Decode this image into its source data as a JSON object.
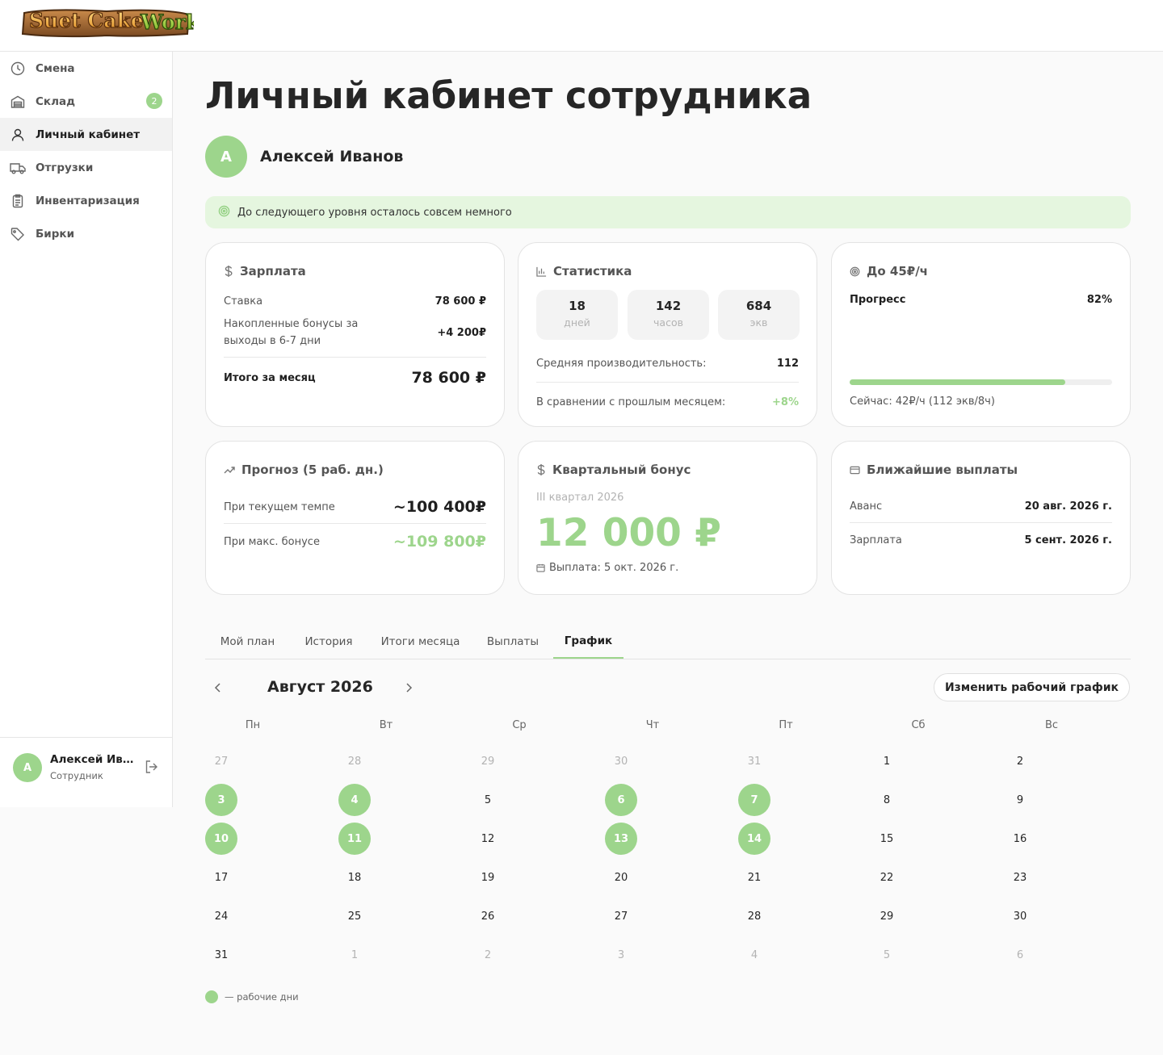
{
  "app": {
    "logo_text": "Suet Cake Work"
  },
  "sidebar": {
    "items": [
      {
        "label": "Смена",
        "icon": "clock-icon"
      },
      {
        "label": "Склад",
        "icon": "warehouse-icon",
        "badge": "2"
      },
      {
        "label": "Личный кабинет",
        "icon": "user-icon",
        "active": true
      },
      {
        "label": "Отгрузки",
        "icon": "truck-icon"
      },
      {
        "label": "Инвентаризация",
        "icon": "clipboard-icon"
      },
      {
        "label": "Бирки",
        "icon": "tag-icon"
      }
    ],
    "user": {
      "initial": "А",
      "name": "Алексей Иван...",
      "role": "Сотрудник"
    }
  },
  "page": {
    "title": "Личный кабинет сотрудника",
    "user_initial": "А",
    "user_name": "Алексей Иванов",
    "banner": "До следующего уровня осталось совсем немного"
  },
  "salary": {
    "title": "Зарплата",
    "rate_label": "Ставка",
    "rate_value": "78 600 ₽",
    "bonus_label_1": "Накопленные бонусы за",
    "bonus_label_2": "выходы в 6-7 дни",
    "bonus_value": "+4 200₽",
    "total_label": "Итого за месяц",
    "total_value": "78 600 ₽"
  },
  "stats": {
    "title": "Статистика",
    "boxes": [
      {
        "value": "18",
        "unit": "дней"
      },
      {
        "value": "142",
        "unit": "часов"
      },
      {
        "value": "684",
        "unit": "экв"
      }
    ],
    "avg_label": "Средняя производительность:",
    "avg_value": "112",
    "compare_label": "В сравнении с прошлым месяцем:",
    "compare_value": "+8%"
  },
  "progress": {
    "title": "До 45₽/ч",
    "label": "Прогресс",
    "value_text": "82%",
    "fraction": 0.82,
    "now": "Сейчас: 42₽/ч (112 экв/8ч)"
  },
  "forecast": {
    "title": "Прогноз (5 раб. дн.)",
    "current_label": "При текущем темпе",
    "current_value": "~100 400₽",
    "max_label": "При макс. бонусе",
    "max_value": "~109 800₽"
  },
  "quarter": {
    "title": "Квартальный бонус",
    "period": "III квартал 2026",
    "amount": "12 000 ₽",
    "payout": "Выплата: 5 окт. 2026 г."
  },
  "payouts": {
    "title": "Ближайшие выплаты",
    "advance_label": "Аванс",
    "advance_value": "20 авг. 2026 г.",
    "salary_label": "Зарплата",
    "salary_value": "5 сент. 2026 г."
  },
  "tabs": [
    "Мой план",
    "История",
    "Итоги месяца",
    "Выплаты",
    "График"
  ],
  "active_tab": "График",
  "calendar": {
    "month": "Август 2026",
    "edit_button": "Изменить рабочий график",
    "weekdays": [
      "Пн",
      "Вт",
      "Ср",
      "Чт",
      "Пт",
      "Сб",
      "Вс"
    ],
    "weeks": [
      [
        {
          "d": "27",
          "out": true
        },
        {
          "d": "28",
          "out": true
        },
        {
          "d": "29",
          "out": true
        },
        {
          "d": "30",
          "out": true
        },
        {
          "d": "31",
          "out": true
        },
        {
          "d": "1"
        },
        {
          "d": "2"
        }
      ],
      [
        {
          "d": "3",
          "work": true
        },
        {
          "d": "4",
          "work": true
        },
        {
          "d": "5"
        },
        {
          "d": "6",
          "work": true
        },
        {
          "d": "7",
          "work": true
        },
        {
          "d": "8"
        },
        {
          "d": "9"
        }
      ],
      [
        {
          "d": "10",
          "work": true
        },
        {
          "d": "11",
          "work": true
        },
        {
          "d": "12"
        },
        {
          "d": "13",
          "work": true
        },
        {
          "d": "14",
          "work": true
        },
        {
          "d": "15"
        },
        {
          "d": "16"
        }
      ],
      [
        {
          "d": "17"
        },
        {
          "d": "18"
        },
        {
          "d": "19"
        },
        {
          "d": "20"
        },
        {
          "d": "21"
        },
        {
          "d": "22"
        },
        {
          "d": "23"
        }
      ],
      [
        {
          "d": "24"
        },
        {
          "d": "25"
        },
        {
          "d": "26"
        },
        {
          "d": "27"
        },
        {
          "d": "28"
        },
        {
          "d": "29"
        },
        {
          "d": "30"
        }
      ],
      [
        {
          "d": "31"
        },
        {
          "d": "1",
          "out": true
        },
        {
          "d": "2",
          "out": true
        },
        {
          "d": "3",
          "out": true
        },
        {
          "d": "4",
          "out": true
        },
        {
          "d": "5",
          "out": true
        },
        {
          "d": "6",
          "out": true
        }
      ]
    ],
    "legend": "— рабочие дни"
  },
  "colors": {
    "accent": "#9dd58c",
    "banner_bg": "#e5f6df"
  }
}
